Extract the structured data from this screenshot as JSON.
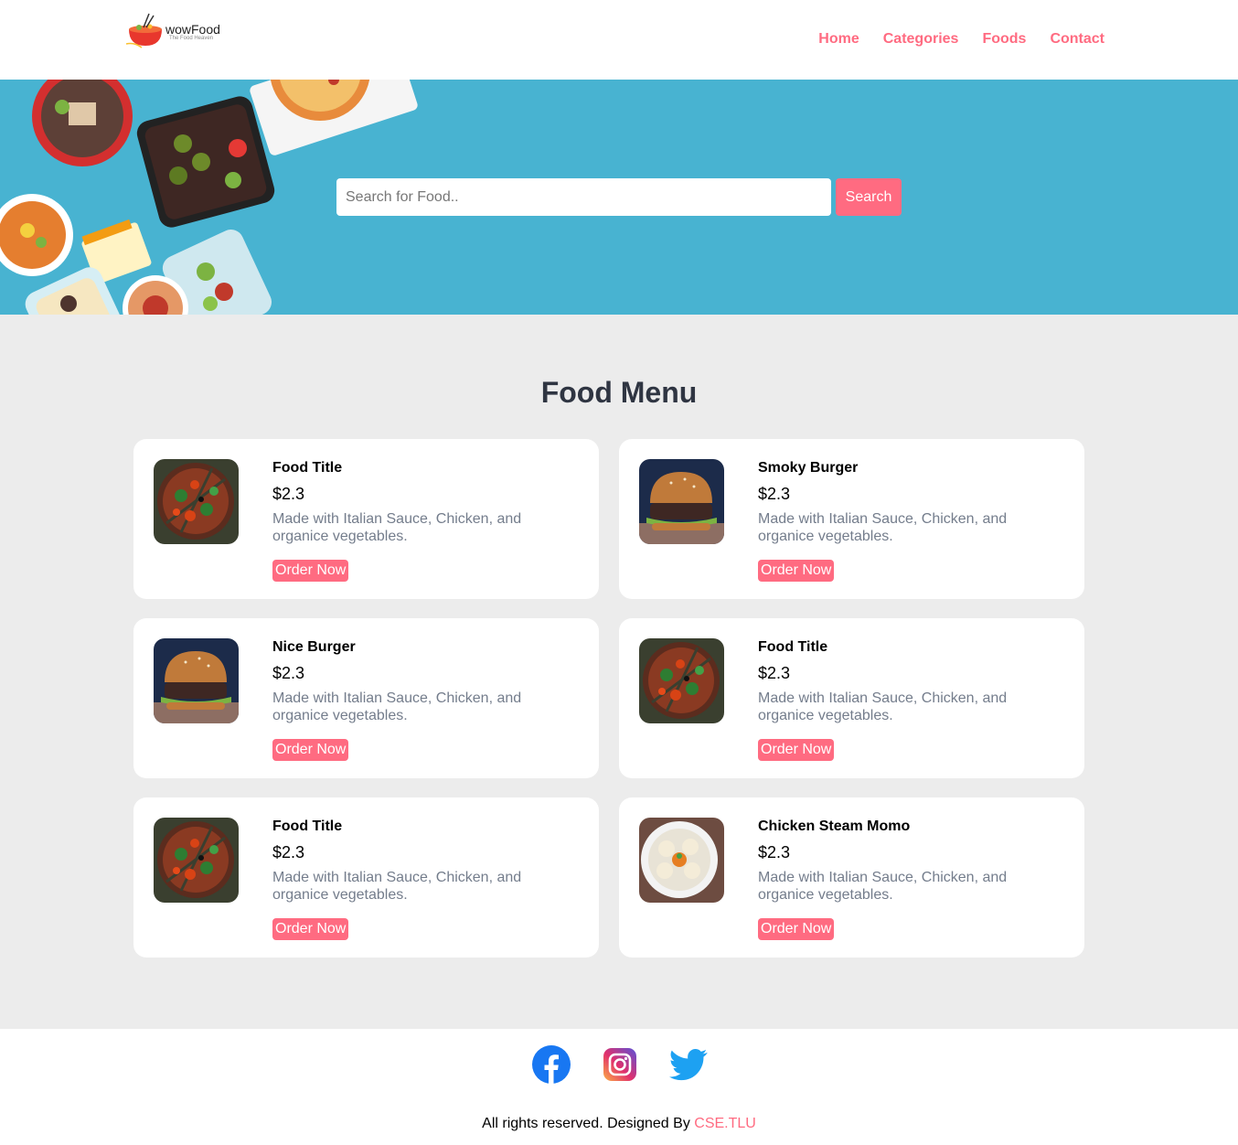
{
  "brand": {
    "name": "wowFood",
    "tagline": "The Food Heaven"
  },
  "nav": {
    "items": [
      {
        "label": "Home"
      },
      {
        "label": "Categories"
      },
      {
        "label": "Foods"
      },
      {
        "label": "Contact"
      }
    ]
  },
  "search": {
    "placeholder": "Search for Food..",
    "button_label": "Search"
  },
  "menu": {
    "title": "Food Menu",
    "items": [
      {
        "title": "Food Title",
        "price": "$2.3",
        "description": "Made with Italian Sauce, Chicken, and organice vegetables.",
        "button": "Order Now",
        "image": "pizza"
      },
      {
        "title": "Smoky Burger",
        "price": "$2.3",
        "description": "Made with Italian Sauce, Chicken, and organice vegetables.",
        "button": "Order Now",
        "image": "burger"
      },
      {
        "title": "Nice Burger",
        "price": "$2.3",
        "description": "Made with Italian Sauce, Chicken, and organice vegetables.",
        "button": "Order Now",
        "image": "burger"
      },
      {
        "title": "Food Title",
        "price": "$2.3",
        "description": "Made with Italian Sauce, Chicken, and organice vegetables.",
        "button": "Order Now",
        "image": "pizza"
      },
      {
        "title": "Food Title",
        "price": "$2.3",
        "description": "Made with Italian Sauce, Chicken, and organice vegetables.",
        "button": "Order Now",
        "image": "pizza"
      },
      {
        "title": "Chicken Steam Momo",
        "price": "$2.3",
        "description": "Made with Italian Sauce, Chicken, and organice vegetables.",
        "button": "Order Now",
        "image": "momo"
      }
    ]
  },
  "footer": {
    "social": [
      {
        "name": "facebook-icon"
      },
      {
        "name": "instagram-icon"
      },
      {
        "name": "twitter-icon"
      }
    ],
    "copyright_prefix": "All rights reserved. Designed By",
    "designer": "CSE.TLU"
  },
  "colors": {
    "accent": "#ff6b81",
    "hero_bg": "#48b3d1",
    "page_bg": "#ececec",
    "heading": "#2f3542",
    "muted_text": "#747d8c"
  }
}
